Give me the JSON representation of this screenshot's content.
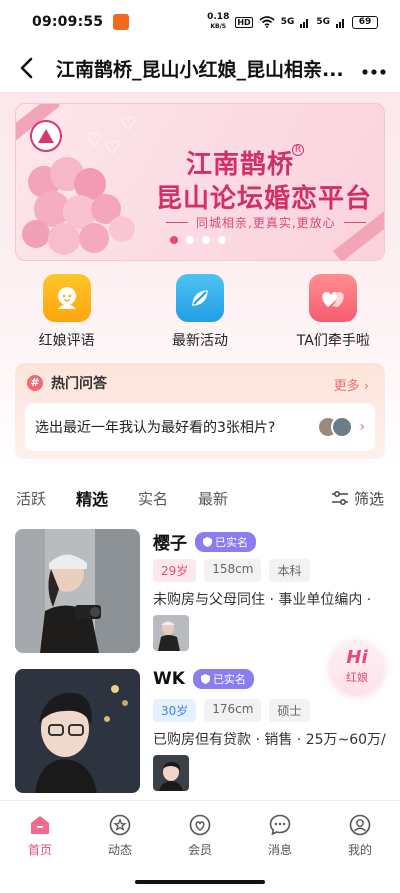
{
  "status_bar": {
    "time": "09:09:55",
    "net_speed_value": "0.18",
    "net_speed_unit": "KB/S",
    "hd": "HD",
    "signal1": "5G",
    "signal2": "5G",
    "battery": "69"
  },
  "header": {
    "title": "江南鹊桥_昆山小红娘_昆山相亲..."
  },
  "banner": {
    "title_line1": "江南鹊桥",
    "title_line2": "昆山论坛婚恋平台",
    "slogan": "同城相亲,更真实,更放心",
    "slide_count": 4,
    "active_slide": 1
  },
  "quick_links": [
    {
      "label": "红娘评语",
      "icon": "matchmaker-review-icon"
    },
    {
      "label": "最新活动",
      "icon": "activity-icon"
    },
    {
      "label": "TA们牵手啦",
      "icon": "couple-hearts-icon"
    }
  ],
  "hot_qa": {
    "title": "热门问答",
    "more": "更多",
    "question": "选出最近一年我认为最好看的3张相片?"
  },
  "tabs": [
    {
      "label": "活跃",
      "active": false
    },
    {
      "label": "精选",
      "active": true
    },
    {
      "label": "实名",
      "active": false
    },
    {
      "label": "最新",
      "active": false
    }
  ],
  "filter_label": "筛选",
  "users": [
    {
      "name": "樱子",
      "verified": "已实名",
      "age": "29岁",
      "height": "158cm",
      "education": "本科",
      "description": "未购房与父母同住 · 事业单位编内 ·"
    },
    {
      "name": "WK",
      "verified": "已实名",
      "age": "30岁",
      "height": "176cm",
      "education": "硕士",
      "description": "已购房但有贷款 · 销售 · 25万~60万/"
    }
  ],
  "floating_button": {
    "hi": "Hi",
    "label": "红娘"
  },
  "bottom_nav": [
    {
      "label": "首页",
      "icon": "home-icon",
      "active": true
    },
    {
      "label": "动态",
      "icon": "feed-icon",
      "active": false
    },
    {
      "label": "会员",
      "icon": "member-icon",
      "active": false
    },
    {
      "label": "消息",
      "icon": "message-icon",
      "active": false
    },
    {
      "label": "我的",
      "icon": "profile-icon",
      "active": false
    }
  ],
  "colors": {
    "accent": "#e84a7b",
    "verified_badge": "#8b7cf0"
  }
}
